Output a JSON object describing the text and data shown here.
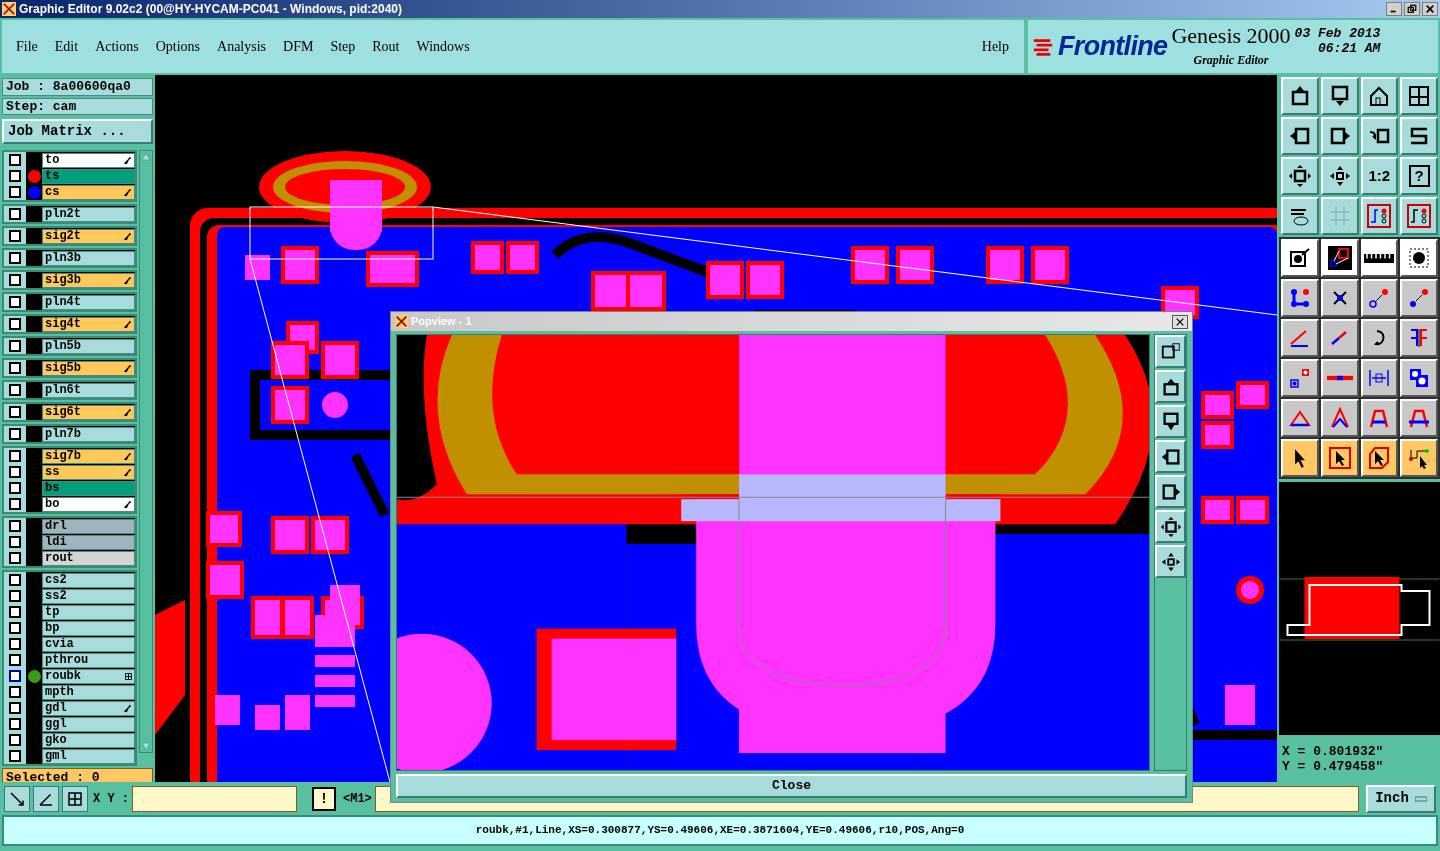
{
  "title_bar": {
    "title": "Graphic Editor 9.02c2 (00@HY-HYCAM-PC041 - Windows, pid:2040)"
  },
  "menu": [
    "File",
    "Edit",
    "Actions",
    "Options",
    "Analysis",
    "DFM",
    "Step",
    "Rout",
    "Windows"
  ],
  "help": "Help",
  "logo": {
    "brand": "Frontline",
    "product": "Genesis 2000",
    "subtitle": "Graphic Editor",
    "date": "03 Feb 2013",
    "time": "06:21 AM"
  },
  "job": {
    "job": "Job : 8a00600qa0",
    "step": "Step: cam",
    "matrix_button": "Job Matrix ..."
  },
  "layer_groups": [
    [
      {
        "name": "to",
        "color": "#ffffff",
        "checked": false,
        "affected": true,
        "active": false
      },
      {
        "name": "ts",
        "color": "#009e7a",
        "dot": {
          "color": "#ff0000"
        },
        "checked": false,
        "affected": false,
        "active": false
      },
      {
        "name": "cs",
        "color": "#ffc85a",
        "dot": {
          "color": "#0000ff"
        },
        "checked": false,
        "affected": true,
        "active": false
      }
    ],
    [
      {
        "name": "pln2t",
        "color": "#a8dcdc",
        "checked": false,
        "affected": false,
        "active": false
      }
    ],
    [
      {
        "name": "sig2t",
        "color": "#ffc85a",
        "checked": false,
        "affected": true,
        "active": false
      }
    ],
    [
      {
        "name": "pln3b",
        "color": "#a8dcdc",
        "checked": false,
        "affected": false,
        "active": false
      }
    ],
    [
      {
        "name": "sig3b",
        "color": "#ffc85a",
        "checked": false,
        "affected": true,
        "active": false
      }
    ],
    [
      {
        "name": "pln4t",
        "color": "#a8dcdc",
        "checked": false,
        "affected": false,
        "active": false
      }
    ],
    [
      {
        "name": "sig4t",
        "color": "#ffc85a",
        "checked": false,
        "affected": true,
        "active": false
      }
    ],
    [
      {
        "name": "pln5b",
        "color": "#a8dcdc",
        "checked": false,
        "affected": false,
        "active": false
      }
    ],
    [
      {
        "name": "sig5b",
        "color": "#ffc85a",
        "checked": false,
        "affected": true,
        "active": false
      }
    ],
    [
      {
        "name": "pln6t",
        "color": "#a8dcdc",
        "checked": false,
        "affected": false,
        "active": false
      }
    ],
    [
      {
        "name": "sig6t",
        "color": "#ffc85a",
        "checked": false,
        "affected": true,
        "active": false
      }
    ],
    [
      {
        "name": "pln7b",
        "color": "#a8dcdc",
        "checked": false,
        "affected": false,
        "active": false
      }
    ],
    [
      {
        "name": "sig7b",
        "color": "#ffc85a",
        "checked": false,
        "affected": true,
        "active": false
      },
      {
        "name": "ss",
        "color": "#ffc85a",
        "checked": false,
        "affected": true,
        "active": false
      },
      {
        "name": "bs",
        "color": "#009e7a",
        "checked": false,
        "affected": false,
        "active": false
      },
      {
        "name": "bo",
        "color": "#ffffff",
        "checked": false,
        "affected": true,
        "active": false
      }
    ],
    [
      {
        "name": "drl",
        "color": "#9fb4bc",
        "checked": false,
        "affected": false,
        "active": false
      },
      {
        "name": "ldi",
        "color": "#9fb4bc",
        "checked": false,
        "affected": false,
        "active": false
      },
      {
        "name": "rout",
        "color": "#d4d4d4",
        "checked": false,
        "affected": false,
        "active": false
      }
    ],
    [
      {
        "name": "cs2",
        "color": "#a8dcdc",
        "checked": false,
        "affected": false,
        "active": false
      },
      {
        "name": "ss2",
        "color": "#a8dcdc",
        "checked": false,
        "affected": false,
        "active": false
      },
      {
        "name": "tp",
        "color": "#a8dcdc",
        "checked": false,
        "affected": false,
        "active": false
      },
      {
        "name": "bp",
        "color": "#a8dcdc",
        "checked": false,
        "affected": false,
        "active": false
      },
      {
        "name": "cvia",
        "color": "#a8dcdc",
        "checked": false,
        "affected": false,
        "active": false
      },
      {
        "name": "pthrou",
        "color": "#a8dcdc",
        "checked": false,
        "affected": false,
        "active": false
      },
      {
        "name": "roubk",
        "color": "#a8dcdc",
        "dot": {
          "color": "#3a9a1a"
        },
        "checked": false,
        "affected": false,
        "active": true
      },
      {
        "name": "mpth",
        "color": "#a8dcdc",
        "checked": false,
        "affected": false,
        "active": false
      },
      {
        "name": "gdl",
        "color": "#a8dcdc",
        "checked": false,
        "affected": true,
        "active": false
      },
      {
        "name": "ggl",
        "color": "#a8dcdc",
        "checked": false,
        "affected": false,
        "active": false
      },
      {
        "name": "gko",
        "color": "#a8dcdc",
        "checked": false,
        "affected": false,
        "active": false
      },
      {
        "name": "gml",
        "color": "#a8dcdc",
        "checked": false,
        "affected": false,
        "active": false
      }
    ]
  ],
  "selected_count": "Selected : 0",
  "view_tools": {
    "ratio": "1:2",
    "help": "?"
  },
  "coords": {
    "x": "X = 0.801932\"",
    "y": "Y = 0.479458\""
  },
  "coord_bar": {
    "label": "X Y :",
    "warn": "!",
    "mode": "<M1>",
    "units": "Inch"
  },
  "status": "roubk,#1,Line,XS=0.300877,YS=0.49606,XE=0.3871604,YE=0.49606,r10,POS,Ang=0",
  "popview": {
    "title": "Popview - 1",
    "close": "Close"
  }
}
